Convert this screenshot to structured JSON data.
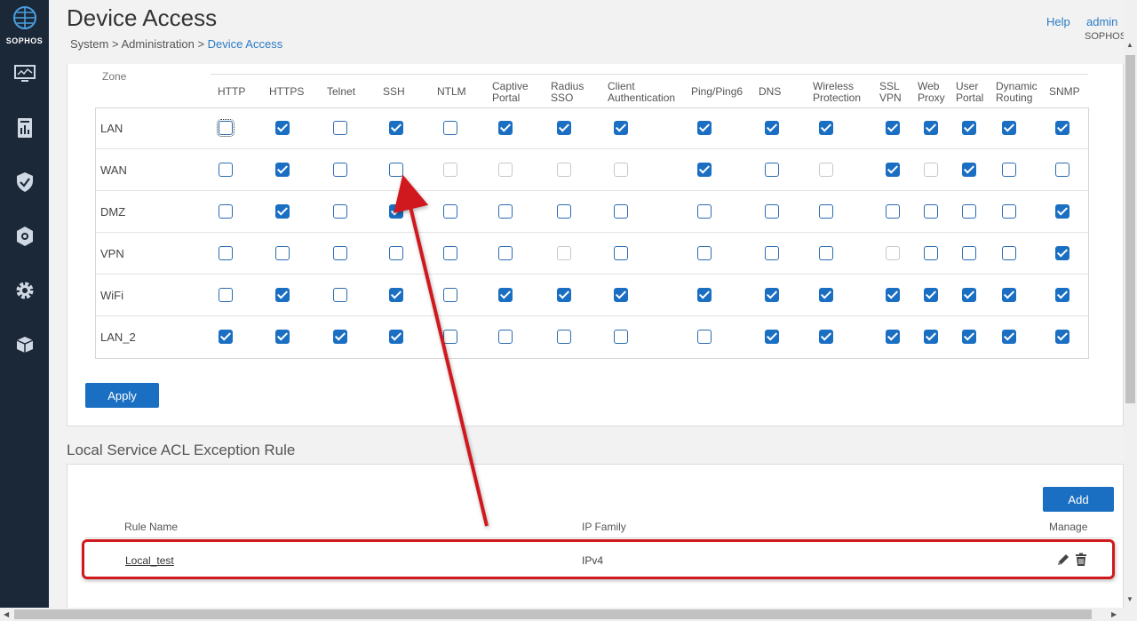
{
  "app": {
    "logo_text": "SOPHOS",
    "brand_color": "#1b2838",
    "accent_color": "#1b6fc2"
  },
  "sidebar": {
    "icons": [
      "monitor-icon",
      "report-icon",
      "shield-icon",
      "protect-icon",
      "gear-icon",
      "cube-icon"
    ]
  },
  "header": {
    "title": "Device Access",
    "breadcrumb": [
      "System",
      "Administration",
      "Device Access"
    ],
    "separator": " > ",
    "help": "Help",
    "user": "admin",
    "org": "SOPHOS"
  },
  "device_access": {
    "zone_header": "Zone",
    "columns": [
      "HTTP",
      "HTTPS",
      "Telnet",
      "SSH",
      "NTLM",
      "Captive Portal",
      "Radius SSO",
      "Client Authentication",
      "Ping/Ping6",
      "DNS",
      "Wireless Protection",
      "SSL VPN",
      "Web Proxy",
      "User Portal",
      "Dynamic Routing",
      "SNMP"
    ],
    "column_lines": [
      [
        "HTTP"
      ],
      [
        "HTTPS"
      ],
      [
        "Telnet"
      ],
      [
        "SSH"
      ],
      [
        "NTLM"
      ],
      [
        "Captive",
        "Portal"
      ],
      [
        "Radius",
        "SSO"
      ],
      [
        "Client",
        "Authentication"
      ],
      [
        "Ping/Ping6"
      ],
      [
        "DNS"
      ],
      [
        "Wireless",
        "Protection"
      ],
      [
        "SSL",
        "VPN"
      ],
      [
        "Web",
        "Proxy"
      ],
      [
        "User",
        "Portal"
      ],
      [
        "Dynamic",
        "Routing"
      ],
      [
        "SNMP"
      ]
    ],
    "states_legend": "c = checked, u = unchecked, d = disabled, f = focused-unchecked",
    "rows": [
      {
        "zone": "LAN",
        "states": [
          "f",
          "c",
          "u",
          "c",
          "u",
          "c",
          "c",
          "c",
          "c",
          "c",
          "c",
          "c",
          "c",
          "c",
          "c",
          "c"
        ]
      },
      {
        "zone": "WAN",
        "states": [
          "u",
          "c",
          "u",
          "u",
          "d",
          "d",
          "d",
          "d",
          "c",
          "u",
          "d",
          "c",
          "d",
          "c",
          "u",
          "u"
        ]
      },
      {
        "zone": "DMZ",
        "states": [
          "u",
          "c",
          "u",
          "c",
          "u",
          "u",
          "u",
          "u",
          "u",
          "u",
          "u",
          "u",
          "u",
          "u",
          "u",
          "c"
        ]
      },
      {
        "zone": "VPN",
        "states": [
          "u",
          "u",
          "u",
          "u",
          "u",
          "u",
          "d",
          "u",
          "u",
          "u",
          "u",
          "d",
          "u",
          "u",
          "u",
          "c"
        ]
      },
      {
        "zone": "WiFi",
        "states": [
          "u",
          "c",
          "u",
          "c",
          "u",
          "c",
          "c",
          "c",
          "c",
          "c",
          "c",
          "c",
          "c",
          "c",
          "c",
          "c"
        ]
      },
      {
        "zone": "LAN_2",
        "states": [
          "c",
          "c",
          "c",
          "c",
          "u",
          "u",
          "u",
          "u",
          "u",
          "c",
          "c",
          "c",
          "c",
          "c",
          "c",
          "c"
        ]
      }
    ],
    "apply_label": "Apply"
  },
  "acl": {
    "section_title": "Local Service ACL Exception Rule",
    "add_label": "Add",
    "columns": {
      "rule_name": "Rule Name",
      "ip_family": "IP Family",
      "manage": "Manage"
    },
    "rules": [
      {
        "name": "Local_test",
        "ip_family": "IPv4"
      }
    ]
  },
  "annotation": {
    "color": "#d0191e"
  }
}
